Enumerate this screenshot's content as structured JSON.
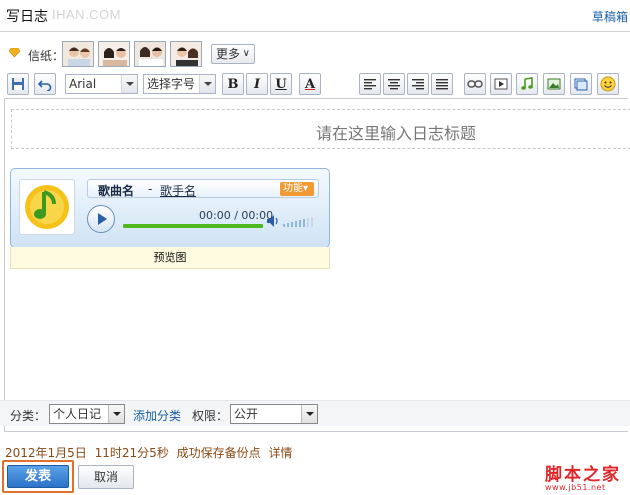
{
  "header": {
    "title": "写日志",
    "watermark": "IHAN.COM",
    "drafts_label": "草稿箱"
  },
  "stationery": {
    "label": "信纸：",
    "more_label": "更多"
  },
  "toolbar": {
    "font_family": "Arial",
    "font_size_placeholder": "选择字号",
    "bold": "B",
    "italic": "I",
    "underline": "U",
    "font_color": "A"
  },
  "editor": {
    "title_placeholder": "请在这里输入日志标题"
  },
  "player": {
    "song_label": "歌曲名",
    "separator": "-",
    "artist_label": "歌手名",
    "function_label": "功能",
    "time_display": "00:00 / 00:00",
    "preview_label": "预览图"
  },
  "category_row": {
    "category_label": "分类：",
    "category_value": "个人日记",
    "add_category": "添加分类",
    "permission_label": "权限：",
    "permission_value": "公开"
  },
  "status": {
    "date": "2012年1月5日",
    "time": "11时21分5秒",
    "message": "成功保存备份点",
    "details": "详情"
  },
  "actions": {
    "publish": "发表",
    "cancel": "取消"
  },
  "site_watermark": {
    "name": "脚本之家",
    "url": "www.jb51.net"
  },
  "colors": {
    "accent_orange": "#e0702e",
    "link_blue": "#1a5fa8",
    "publish_blue": "#2c72c8",
    "status_brown": "#8a4a14",
    "watermark_red": "#e3262a",
    "progress_green": "#4eb81e"
  }
}
